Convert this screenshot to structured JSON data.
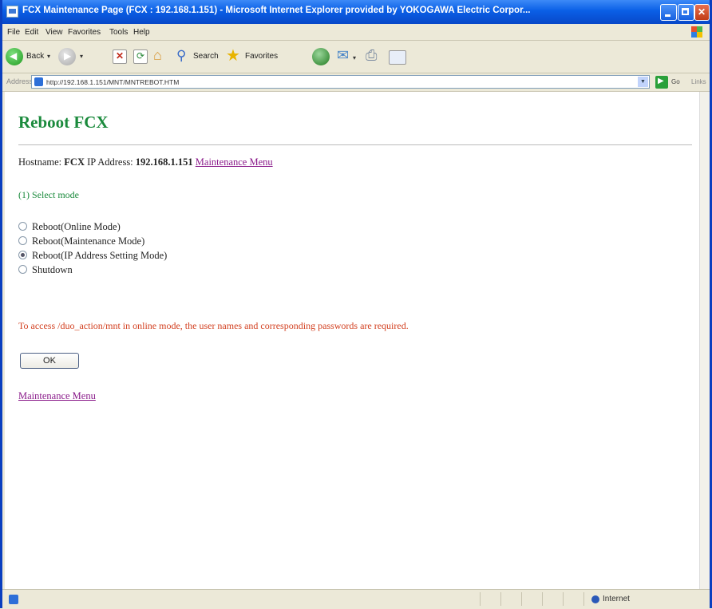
{
  "window": {
    "title": "FCX Maintenance Page (FCX : 192.168.1.151) - Microsoft Internet Explorer provided by YOKOGAWA Electric Corpor..."
  },
  "menu": [
    "File",
    "Edit",
    "View",
    "Favorites",
    "Tools",
    "Help"
  ],
  "toolbar": {
    "back_label": "Back",
    "search_label": "Search",
    "favorites_label": "Favorites"
  },
  "address": {
    "label": "Address",
    "url": "http://192.168.1.151/MNT/MNTREBOT.HTM",
    "go_label": "Go",
    "links_label": "Links"
  },
  "page": {
    "heading": "Reboot FCX",
    "hostname_label": "Hostname:",
    "hostname_value": "FCX",
    "ip_label": "IP Address:",
    "ip_value": "192.168.1.151",
    "maintenance_link": "Maintenance Menu",
    "step_label": "(1) Select mode",
    "options": [
      {
        "label": "Reboot(Online Mode)",
        "checked": false
      },
      {
        "label": "Reboot(Maintenance Mode)",
        "checked": false
      },
      {
        "label": "Reboot(IP Address Setting Mode)",
        "checked": true
      },
      {
        "label": "Shutdown",
        "checked": false
      }
    ],
    "warning": "To access /duo_action/mnt in online mode, the user names and corresponding passwords are required.",
    "ok_label": "OK",
    "bottom_link": "Maintenance Menu"
  },
  "status": {
    "zone": "Internet"
  }
}
